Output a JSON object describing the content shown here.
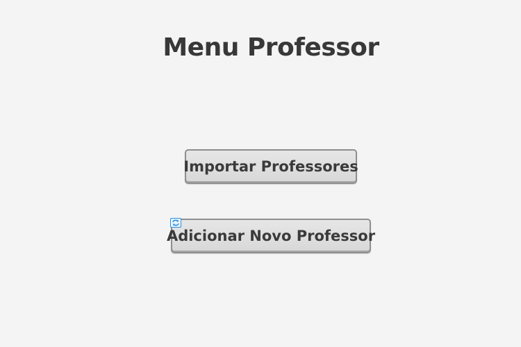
{
  "header": {
    "title": "Menu Professor"
  },
  "actions": {
    "import_label": "Importar Professores",
    "add_label": "Adicionar Novo Professor"
  },
  "icons": {
    "overlay_icon": "refresh-icon"
  },
  "colors": {
    "background": "#f4f4f4",
    "text": "#383838",
    "button_face": "#dedede",
    "button_border": "#8e8e8e",
    "icon_blue": "#2b8fe0"
  }
}
